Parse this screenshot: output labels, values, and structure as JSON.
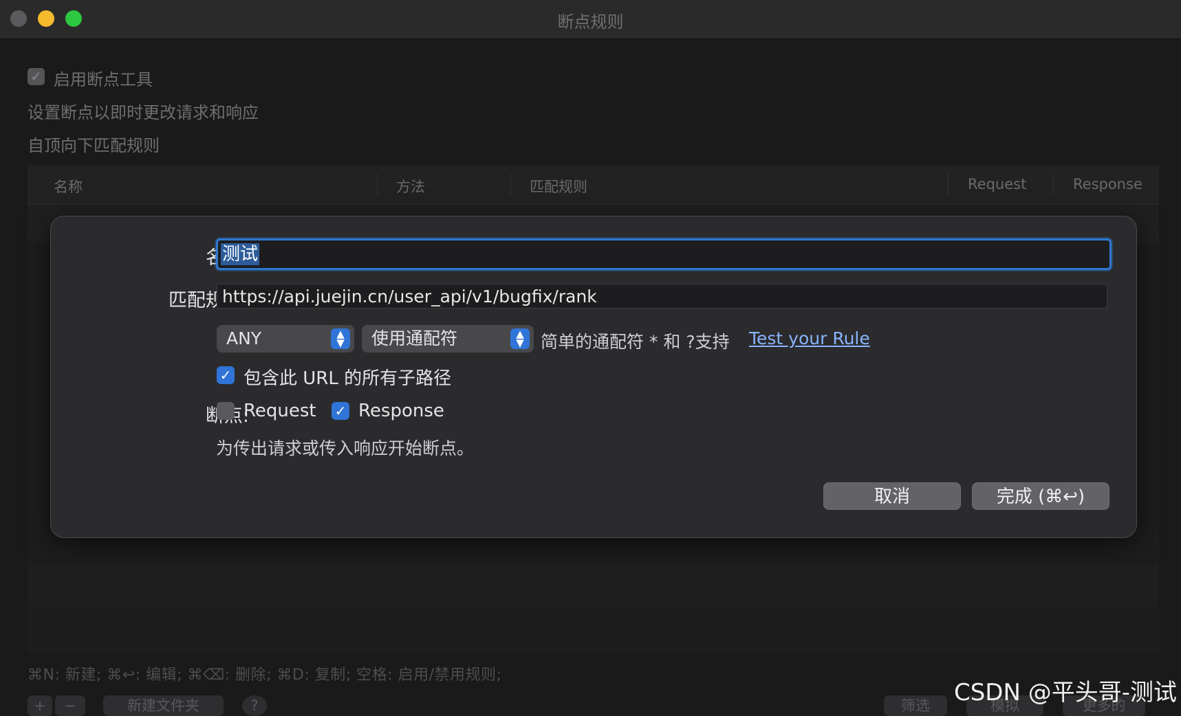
{
  "window": {
    "title": "断点规则"
  },
  "background": {
    "enable_label": "启用断点工具",
    "enable_checked": true,
    "subtitle": "设置断点以即时更改请求和响应",
    "order_note": "自顶向下匹配规则",
    "table_headers": [
      "名称",
      "方法",
      "匹配规则",
      "Request",
      "Response"
    ],
    "shortcuts": "⌘N: 新建; ⌘↩: 编辑; ⌘⌫: 删除; ⌘D: 复制; 空格: 启用/禁用规则;",
    "bottom_buttons": [
      "+",
      "−",
      "新建文件夹",
      "?",
      "筛选",
      "模拟",
      "更多的"
    ]
  },
  "dialog": {
    "name_label": "名称:",
    "name_value": "测试",
    "rule_label": "匹配规则:",
    "rule_value": "https://api.juejin.cn/user_api/v1/bugfix/rank",
    "method_select": "ANY",
    "match_type_select": "使用通配符",
    "wildcard_hint": "简单的通配符 * 和 ?支持",
    "test_link": "Test your Rule",
    "include_subpaths_label": "包含此 URL 的所有子路径",
    "include_subpaths_checked": true,
    "breakpoint_label": "断点:",
    "request_label": "Request",
    "request_checked": false,
    "response_label": "Response",
    "response_checked": true,
    "description": "为传出请求或传入响应开始断点。",
    "cancel_button": "取消",
    "done_button": "完成 (⌘↩)"
  },
  "watermark": "CSDN @平头哥-测试"
}
